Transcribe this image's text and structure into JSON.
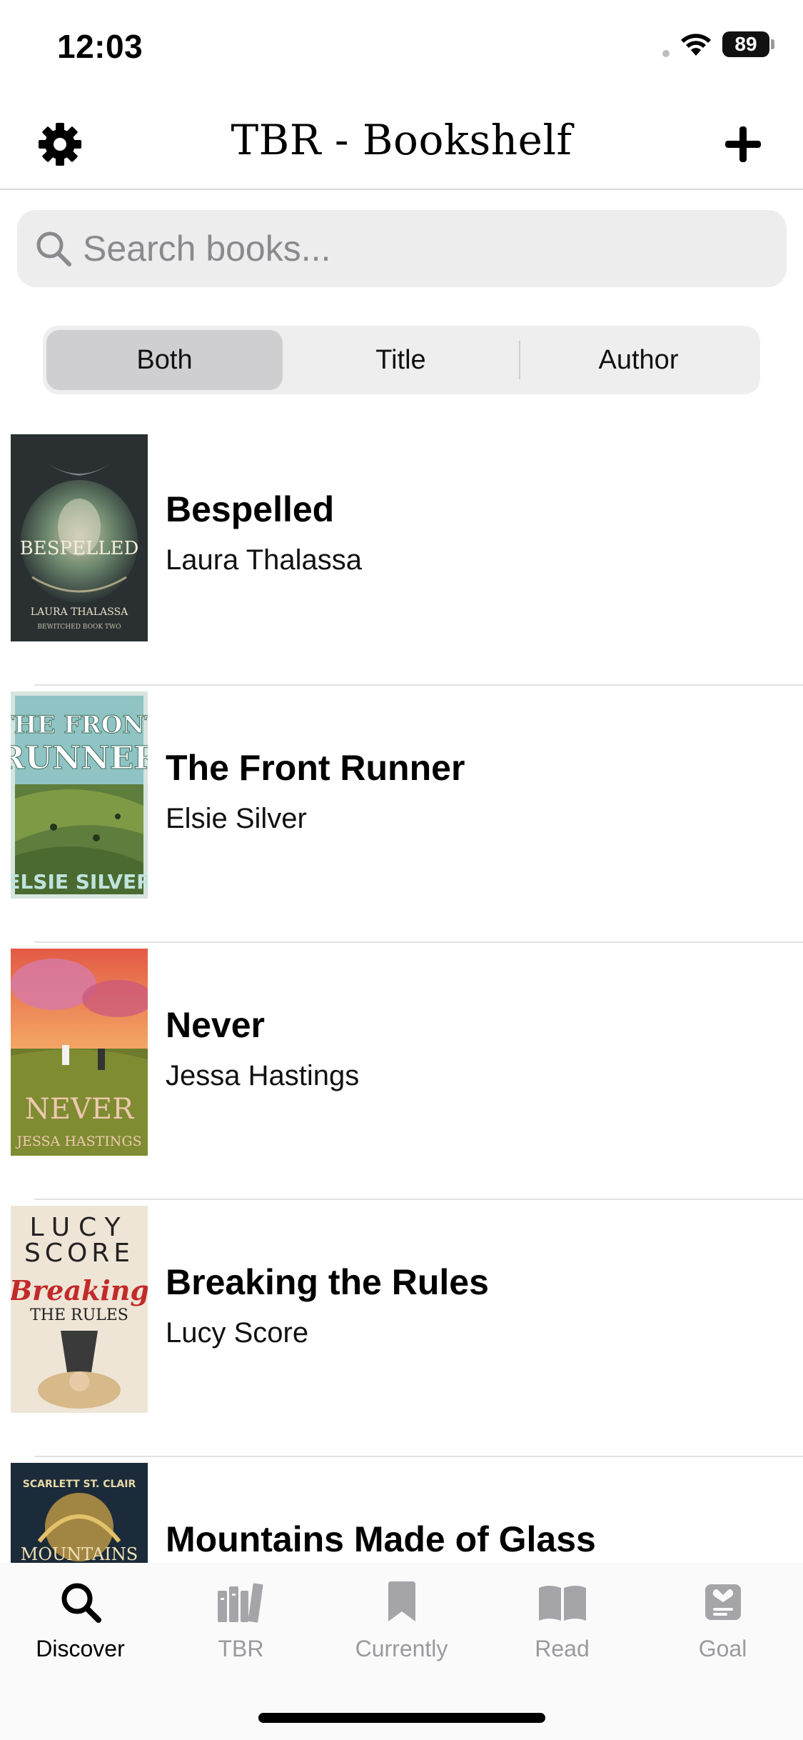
{
  "status_bar": {
    "time": "12:03",
    "battery": "89"
  },
  "nav": {
    "title": "TBR - Bookshelf",
    "settings_icon": "gear-icon",
    "add_icon": "plus-icon"
  },
  "search": {
    "placeholder": "Search books...",
    "value": ""
  },
  "segments": {
    "items": [
      "Both",
      "Title",
      "Author"
    ],
    "selected": "Both"
  },
  "books": [
    {
      "title": "Bespelled",
      "author": "Laura Thalassa",
      "cover_text": [
        "BESPELLED",
        "LAURA THALASSA",
        "BEWITCHED BOOK TWO"
      ]
    },
    {
      "title": "The Front Runner",
      "author": "Elsie Silver",
      "cover_text": [
        "THE FRONT",
        "RUNNER",
        "ELSIE SILVER"
      ]
    },
    {
      "title": "Never",
      "author": "Jessa Hastings",
      "cover_text": [
        "NEVER",
        "JESSA HASTINGS"
      ]
    },
    {
      "title": "Breaking the Rules",
      "author": "Lucy Score",
      "cover_text": [
        "LUCY",
        "SCORE",
        "Breaking",
        "THE RULES"
      ]
    },
    {
      "title": "Mountains Made of Glass",
      "author": "",
      "cover_text": [
        "SCARLETT ST. CLAIR",
        "MOUNTAINS"
      ]
    }
  ],
  "tabs": [
    {
      "label": "Discover",
      "icon": "search-icon",
      "active": true
    },
    {
      "label": "TBR",
      "icon": "books-icon",
      "active": false
    },
    {
      "label": "Currently",
      "icon": "bookmark-icon",
      "active": false
    },
    {
      "label": "Read",
      "icon": "open-book-icon",
      "active": false
    },
    {
      "label": "Goal",
      "icon": "goal-card-icon",
      "active": false
    }
  ],
  "colors": {
    "accent": "#000000",
    "inactive_tab": "#9a9a9e",
    "segment_bg": "#eeeeef",
    "segment_selected": "#cfcfd1",
    "search_bg": "#ededee"
  }
}
